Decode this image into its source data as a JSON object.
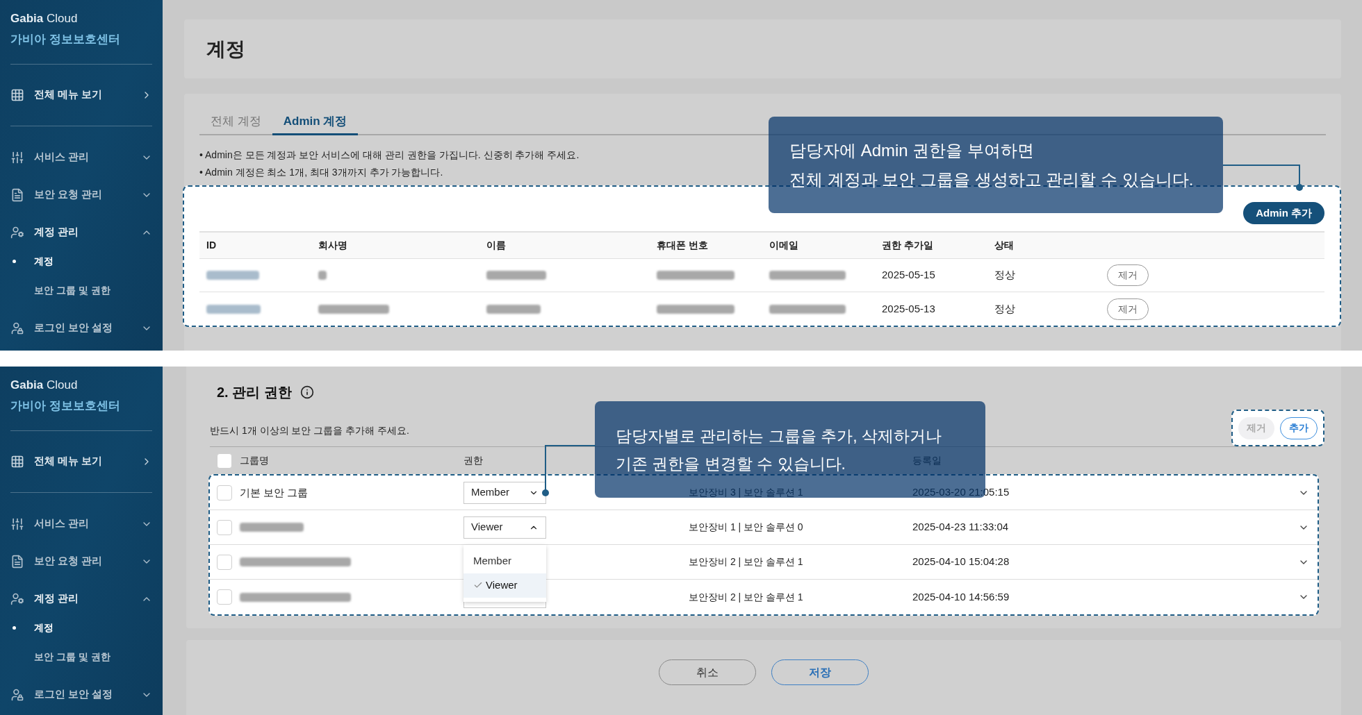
{
  "top": {
    "sidebar": {
      "brand": "**Gabia** Cloud",
      "subtitle": "가비아 정보보호센터",
      "all_menu": "전체 메뉴 보기",
      "items": [
        {
          "label": "서비스 관리",
          "kind": "sliders",
          "expanded": false
        },
        {
          "label": "보안 요청 관리",
          "kind": "document",
          "expanded": false
        },
        {
          "label": "계정 관리",
          "kind": "user-gear",
          "expanded": true,
          "children": [
            {
              "label": "계정",
              "selected": true
            },
            {
              "label": "보안 그룹 및 권한",
              "selected": false
            }
          ]
        },
        {
          "label": "로그인 보안 설정",
          "kind": "user-lock",
          "expanded": false
        }
      ]
    },
    "page_title": "계정",
    "tabs": [
      {
        "label": "전체 계정",
        "selected": false
      },
      {
        "label": "Admin 계정",
        "selected": true
      }
    ],
    "notes": [
      "• Admin은 모든 계정과 보안 서비스에 대해 관리 권한을 가집니다. 신중히 추가해 주세요.",
      "• Admin 계정은 최소 1개, 최대 3개까지 추가 가능합니다."
    ],
    "add_button": "Admin 추가",
    "table": {
      "columns": [
        "ID",
        "회사명",
        "이름",
        "휴대폰 번호",
        "이메일",
        "권한 추가일",
        "상태"
      ],
      "rows": [
        {
          "added": "2025-05-15",
          "status": "정상",
          "action": "제거"
        },
        {
          "added": "2025-05-13",
          "status": "정상",
          "action": "제거"
        }
      ]
    },
    "callout": [
      "담당자에 Admin 권한을 부여하면",
      "전체 계정과 보안 그룹을 생성하고 관리할 수 있습니다."
    ]
  },
  "bottom": {
    "sidebar": {
      "brand": "**Gabia** Cloud",
      "subtitle": "가비아 정보보호센터",
      "all_menu": "전체 메뉴 보기",
      "items": [
        {
          "label": "서비스 관리",
          "kind": "sliders",
          "expanded": false
        },
        {
          "label": "보안 요청 관리",
          "kind": "document",
          "expanded": false
        },
        {
          "label": "계정 관리",
          "kind": "user-gear",
          "expanded": true,
          "children": [
            {
              "label": "계정",
              "selected": true
            },
            {
              "label": "보안 그룹 및 권한",
              "selected": false
            }
          ]
        },
        {
          "label": "로그인 보안 설정",
          "kind": "user-lock",
          "expanded": false
        }
      ]
    },
    "section_title": "2. 관리 권한",
    "hint": "반드시 1개 이상의 보안 그룹을 추가해 주세요.",
    "buttons": [
      {
        "label": "제거",
        "disabled": true
      },
      {
        "label": "추가",
        "disabled": false
      }
    ],
    "table": {
      "header_checked": false,
      "columns": [
        "그룹명",
        "권한",
        "등록일"
      ],
      "rows": [
        {
          "checked": false,
          "name": "기본 보안 그룹",
          "role": "Member",
          "expanded": false,
          "summary": "보안장비 3 | 보안 솔루션 1",
          "date": "2025-03-20 21:05:15"
        },
        {
          "checked": false,
          "role": "Viewer",
          "expanded": true,
          "options": [
            {
              "label": "Member",
              "selected": false
            },
            {
              "label": "Viewer",
              "selected": true
            }
          ],
          "summary": "보안장비 1 | 보안 솔루션 0",
          "date": "2025-04-23 11:33:04"
        },
        {
          "checked": false,
          "summary": "보안장비 2 | 보안 솔루션 1",
          "date": "2025-04-10 15:04:28"
        },
        {
          "checked": false,
          "summary": "보안장비 2 | 보안 솔루션 1",
          "date": "2025-04-10 14:56:59"
        }
      ]
    },
    "callout": [
      "담당자별로 관리하는 그룹을 추가, 삭제하거나",
      "기존 권한을 변경할 수 있습니다."
    ],
    "cancel": "취소",
    "save": "저장"
  }
}
